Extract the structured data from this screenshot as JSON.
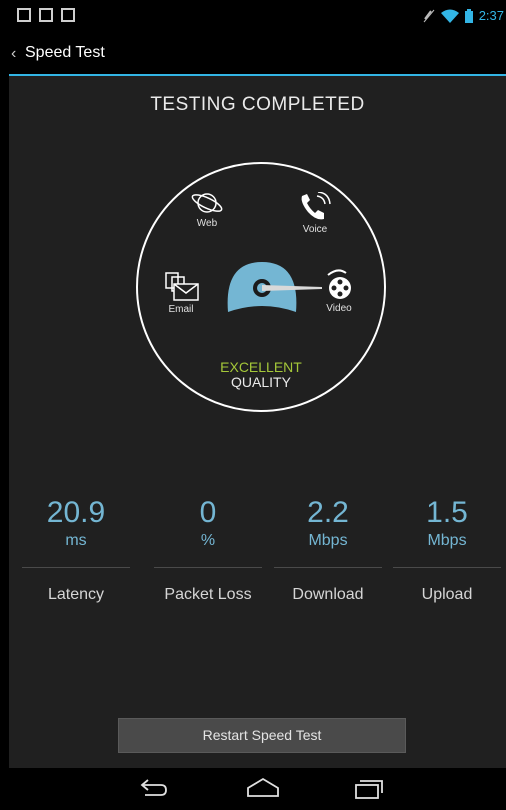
{
  "status_bar": {
    "time": "2:37"
  },
  "action_bar": {
    "back": "‹",
    "title": "Speed Test"
  },
  "main": {
    "heading": "TESTING COMPLETED",
    "features": {
      "web": "Web",
      "voice": "Voice",
      "email": "Email",
      "video": "Video"
    },
    "quality_rating": "EXCELLENT",
    "quality_label": "QUALITY",
    "metrics": [
      {
        "value": "20.9",
        "unit": "ms",
        "label": "Latency"
      },
      {
        "value": "0",
        "unit": "%",
        "label": "Packet Loss"
      },
      {
        "value": "2.2",
        "unit": "Mbps",
        "label": "Download"
      },
      {
        "value": "1.5",
        "unit": "Mbps",
        "label": "Upload"
      }
    ],
    "restart_label": "Restart Speed Test"
  },
  "colors": {
    "accent": "#33b5e5",
    "metric": "#74b6d3",
    "excellent": "#a4c739",
    "background": "#202020"
  },
  "nav_icons": [
    "back-icon",
    "home-icon",
    "recent-apps-icon"
  ]
}
